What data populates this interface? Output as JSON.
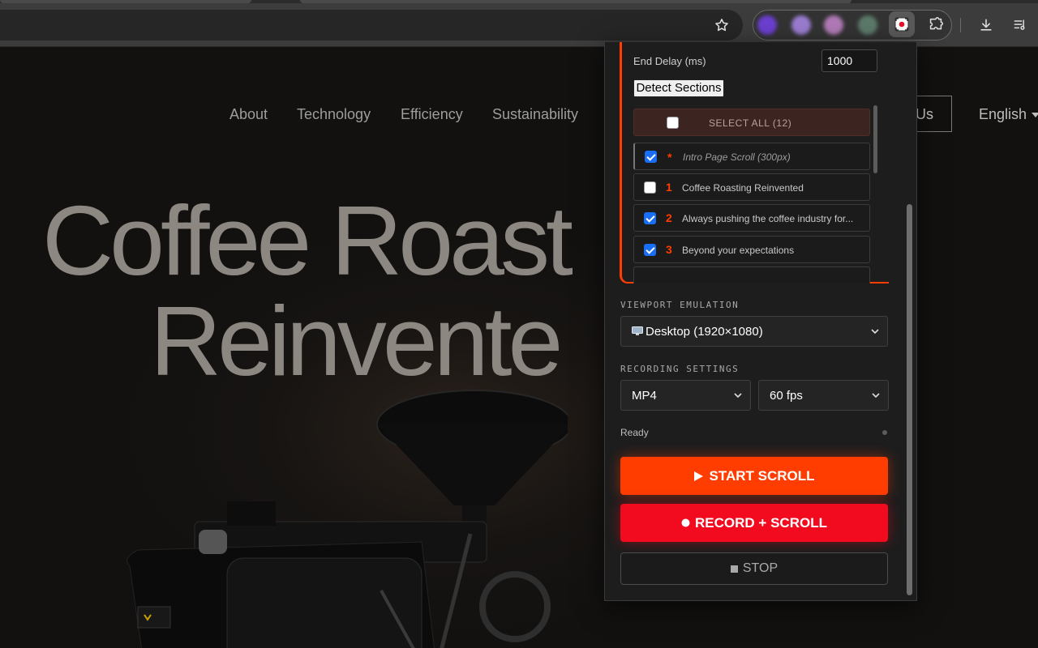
{
  "browser": {
    "extensions": [
      {
        "name": "extension-1",
        "color": "#6b3fd0"
      },
      {
        "name": "extension-2",
        "color": "#9a7cd0"
      },
      {
        "name": "extension-3",
        "color": "#b07ab6"
      },
      {
        "name": "extension-4",
        "color": "#5b7a6a"
      }
    ],
    "active_extension_icon": "screen-record-icon"
  },
  "site": {
    "nav": [
      "About",
      "Technology",
      "Efficiency",
      "Sustainability"
    ],
    "contact_partial": "Us",
    "language": "English",
    "hero_line1": "Coffee Roast",
    "hero_line2": "Reinvente"
  },
  "popup": {
    "end_delay_label": "End Delay (ms)",
    "end_delay_value": "1000",
    "detect_button": "Detect Sections",
    "select_all_label": "SELECT ALL (12)",
    "sections": [
      {
        "marker": "*",
        "title": "Intro Page Scroll (300px)",
        "checked": true,
        "italic": true
      },
      {
        "marker": "1",
        "title": "Coffee Roasting Reinvented",
        "checked": false,
        "italic": false
      },
      {
        "marker": "2",
        "title": "Always pushing the coffee industry for...",
        "checked": true,
        "italic": false
      },
      {
        "marker": "3",
        "title": "Beyond your expectations",
        "checked": true,
        "italic": false
      }
    ],
    "viewport_caption": "VIEWPORT EMULATION",
    "viewport_value": "Desktop (1920×1080)",
    "recording_caption": "RECORDING SETTINGS",
    "format_value": "MP4",
    "fps_value": "60 fps",
    "status_text": "Ready",
    "start_label": "START SCROLL",
    "record_label": "RECORD + SCROLL",
    "stop_label": "STOP"
  },
  "colors": {
    "accent_orange": "#ff3d00",
    "accent_red": "#f20a1f",
    "checkbox_blue": "#1a6ef5"
  }
}
